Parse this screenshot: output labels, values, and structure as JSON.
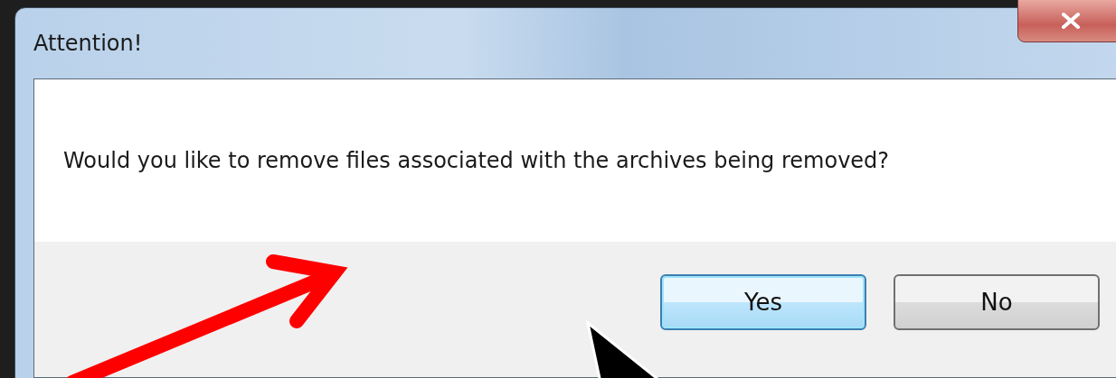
{
  "window": {
    "title": "Attention!"
  },
  "message": "Would you like to remove files associated with the archives being removed?",
  "buttons": [
    {
      "label": "Yes",
      "default": true
    },
    {
      "label": "No",
      "default": false
    }
  ]
}
